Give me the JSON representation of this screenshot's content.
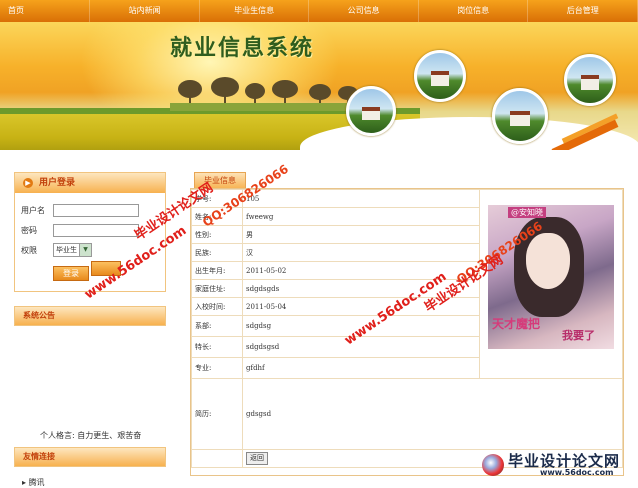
{
  "nav": {
    "items": [
      "首页",
      "站内新闻",
      "毕业生信息",
      "公司信息",
      "岗位信息",
      "后台管理"
    ]
  },
  "banner": {
    "title": "就业信息系统"
  },
  "login": {
    "header": "用户登录",
    "username_label": "用户名",
    "password_label": "密码",
    "role_label": "权限",
    "role_value": "毕业生",
    "submit_label": "登录"
  },
  "announcement": {
    "header": "系统公告"
  },
  "motto": "个人格言: 自力更生、艰苦奋",
  "friend_links": {
    "header": "友情连接",
    "items": [
      "腾讯"
    ]
  },
  "main": {
    "tab_label": "毕业信息",
    "rows": [
      {
        "key": "学号:",
        "value": "105"
      },
      {
        "key": "姓名:",
        "value": "fweewg"
      },
      {
        "key": "性别:",
        "value": "男"
      },
      {
        "key": "民族:",
        "value": "汉"
      },
      {
        "key": "出生年月:",
        "value": "2011-05-02"
      },
      {
        "key": "家庭住址:",
        "value": "sdgdsgds"
      },
      {
        "key": "入校时间:",
        "value": "2011-05-04"
      },
      {
        "key": "系部:",
        "value": "sdgdsg"
      },
      {
        "key": "特长:",
        "value": "sdgdsgsd"
      },
      {
        "key": "专业:",
        "value": "gfdhf"
      },
      {
        "key": "简历:",
        "value": "gdsgsd"
      }
    ],
    "back_label": "返回",
    "photo_text_1": "天才魔把",
    "photo_text_2": "我要了",
    "photo_logo": "@安知晓"
  },
  "watermarks": {
    "site_name": "毕业设计论文网",
    "qq": "QQ:306826066",
    "url": "www.56doc.com"
  },
  "brand": {
    "name": "毕业设计论文网",
    "url": "www.56doc.com"
  }
}
